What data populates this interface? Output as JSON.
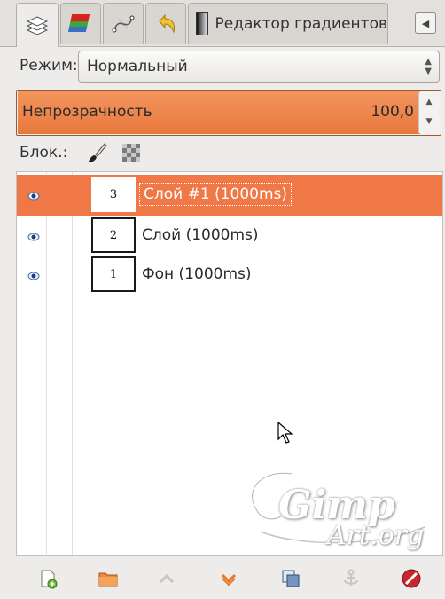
{
  "tabs": {
    "gradient_editor_label": "Редактор градиентов"
  },
  "mode": {
    "label": "Режим:",
    "value": "Нормальный"
  },
  "opacity": {
    "label": "Непрозрачность",
    "value": "100,0",
    "fraction": 1.0
  },
  "lock": {
    "label": "Блок.:"
  },
  "layers": [
    {
      "thumb": "3",
      "name": "Слой #1 (1000ms)",
      "selected": true
    },
    {
      "thumb": "2",
      "name": "Слой (1000ms)",
      "selected": false
    },
    {
      "thumb": "1",
      "name": "Фон (1000ms)",
      "selected": false
    }
  ],
  "watermark": {
    "line1": "Gimp",
    "line2": "Art.org"
  },
  "colors": {
    "accent": "#f07746",
    "panel": "#edeceb"
  },
  "icons": {
    "tabs": [
      "layers-tab-icon",
      "channels-tab-icon",
      "paths-tab-icon",
      "undo-history-tab-icon",
      "gradient-swatch-icon"
    ],
    "toolbar": [
      "new-layer-icon",
      "new-layer-group-icon",
      "raise-layer-icon",
      "lower-layer-icon",
      "duplicate-layer-icon",
      "anchor-layer-icon",
      "delete-layer-icon"
    ]
  }
}
